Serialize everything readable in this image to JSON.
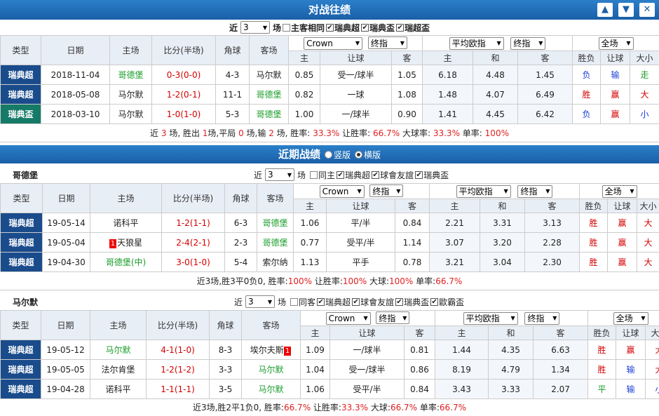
{
  "h2h": {
    "title": "对战往绩",
    "window_buttons": [
      "▲",
      "▼",
      "✕"
    ],
    "filter": {
      "near": "近",
      "count": "3",
      "unit": "场",
      "same_home": "主客相同",
      "leagues": [
        "瑞典超",
        "瑞典盃",
        "瑞超盃"
      ]
    },
    "odds": {
      "company": "Crown",
      "type": "终指",
      "avg": "平均欧指",
      "avg_type": "终指",
      "scope": "全场"
    },
    "headers": {
      "type": "类型",
      "date": "日期",
      "home": "主场",
      "score": "比分(半场)",
      "corner": "角球",
      "away": "客场",
      "h": "主",
      "hcp": "让球",
      "a": "客",
      "eh": "主",
      "ed": "和",
      "ea": "客",
      "wl": "胜负",
      "hres": "让球",
      "ou": "大小"
    },
    "rows": [
      {
        "type": "瑞典超",
        "date": "2018-11-04",
        "home": "哥德堡",
        "score": "0-3(0-0)",
        "corner": "4-3",
        "away": "马尔默",
        "h": "0.85",
        "hcp": "受一/球半",
        "a": "1.05",
        "eh": "6.18",
        "ed": "4.48",
        "ea": "1.45",
        "wl": "负",
        "hres": "输",
        "ou": "走"
      },
      {
        "type": "瑞典超",
        "date": "2018-05-08",
        "home": "马尔默",
        "score": "1-2(0-1)",
        "corner": "11-1",
        "away": "哥德堡",
        "h": "0.82",
        "hcp": "一球",
        "a": "1.08",
        "eh": "1.48",
        "ed": "4.07",
        "ea": "6.49",
        "wl": "胜",
        "hres": "赢",
        "ou": "大"
      },
      {
        "type": "瑞典盃",
        "date": "2018-03-10",
        "home": "马尔默",
        "score": "1-0(1-0)",
        "corner": "5-3",
        "away": "哥德堡",
        "h": "1.00",
        "hcp": "一/球半",
        "a": "0.90",
        "eh": "1.41",
        "ed": "4.45",
        "ea": "6.42",
        "wl": "负",
        "hres": "赢",
        "ou": "小"
      }
    ],
    "summary": {
      "t1": "近",
      "n": "3",
      "t2": "场, 胜出",
      "w": "1",
      "t3": "场,平局",
      "d": "0",
      "t4": "场,输",
      "l": "2",
      "t5": "场, 胜率:",
      "wr": "33.3%",
      "t6": "让胜率:",
      "hr": "66.7%",
      "t7": "大球率:",
      "br": "33.3%",
      "t8": "单率:",
      "orr": "100%"
    }
  },
  "recent": {
    "title": "近期战绩",
    "view_vertical": "竖版",
    "view_horizontal": "横版"
  },
  "team1": {
    "name": "哥德堡",
    "filter": {
      "near": "近",
      "count": "3",
      "unit": "场",
      "same": "同主",
      "leagues": [
        "瑞典超",
        "球會友誼",
        "瑞典盃"
      ]
    },
    "odds": {
      "company": "Crown",
      "type": "终指",
      "avg": "平均欧指",
      "avg_type": "终指",
      "scope": "全场"
    },
    "rows": [
      {
        "type": "瑞典超",
        "date": "19-05-14",
        "home": "诺科平",
        "score": "1-2(1-1)",
        "corner": "6-3",
        "away": "哥德堡",
        "h": "1.06",
        "hcp": "平/半",
        "a": "0.84",
        "eh": "2.21",
        "ed": "3.31",
        "ea": "3.13",
        "wl": "胜",
        "hres": "赢",
        "ou": "大"
      },
      {
        "type": "瑞典超",
        "date": "19-05-04",
        "home": "天狼星",
        "home_badge": "1",
        "score": "2-4(2-1)",
        "corner": "2-3",
        "away": "哥德堡",
        "h": "0.77",
        "hcp": "受平/半",
        "a": "1.14",
        "eh": "3.07",
        "ed": "3.20",
        "ea": "2.28",
        "wl": "胜",
        "hres": "赢",
        "ou": "大"
      },
      {
        "type": "瑞典超",
        "date": "19-04-30",
        "home": "哥德堡(中)",
        "score": "3-0(1-0)",
        "corner": "5-4",
        "away": "索尔纳",
        "h": "1.13",
        "hcp": "平手",
        "a": "0.78",
        "eh": "3.21",
        "ed": "3.04",
        "ea": "2.30",
        "wl": "胜",
        "hres": "赢",
        "ou": "大"
      }
    ],
    "summary": {
      "t1": "近3场,胜3平0负0, 胜率:",
      "wr": "100%",
      "t2": " 让胜率:",
      "hr": "100%",
      "t3": " 大球:",
      "br": "100%",
      "t4": " 单率:",
      "orr": "66.7%"
    }
  },
  "team2": {
    "name": "马尔默",
    "filter": {
      "near": "近",
      "count": "3",
      "unit": "场",
      "same": "同客",
      "leagues": [
        "瑞典超",
        "球會友誼",
        "瑞典盃",
        "歐霸盃"
      ]
    },
    "odds": {
      "company": "Crown",
      "type": "终指",
      "avg": "平均欧指",
      "avg_type": "终指",
      "scope": "全场"
    },
    "rows": [
      {
        "type": "瑞典超",
        "date": "19-05-12",
        "home": "马尔默",
        "score": "4-1(1-0)",
        "corner": "8-3",
        "away": "埃尔夫斯",
        "away_badge": "1",
        "h": "1.09",
        "hcp": "一/球半",
        "a": "0.81",
        "eh": "1.44",
        "ed": "4.35",
        "ea": "6.63",
        "wl": "胜",
        "hres": "赢",
        "ou": "大"
      },
      {
        "type": "瑞典超",
        "date": "19-05-05",
        "home": "法尔肯堡",
        "score": "1-2(1-2)",
        "corner": "3-3",
        "away": "马尔默",
        "h": "1.04",
        "hcp": "受一/球半",
        "a": "0.86",
        "eh": "8.19",
        "ed": "4.79",
        "ea": "1.34",
        "wl": "胜",
        "hres": "输",
        "ou": "大"
      },
      {
        "type": "瑞典超",
        "date": "19-04-28",
        "home": "诺科平",
        "score": "1-1(1-1)",
        "corner": "3-5",
        "away": "马尔默",
        "h": "1.06",
        "hcp": "受平/半",
        "a": "0.84",
        "eh": "3.43",
        "ed": "3.33",
        "ea": "2.07",
        "wl": "平",
        "hres": "输",
        "ou": "小"
      }
    ],
    "summary": {
      "t1": "近3场,胜2平1负0, 胜率:",
      "wr": "66.7%",
      "t2": " 让胜率:",
      "hr": "33.3%",
      "t3": " 大球:",
      "br": "66.7%",
      "t4": " 单率:",
      "orr": "66.7%"
    }
  }
}
